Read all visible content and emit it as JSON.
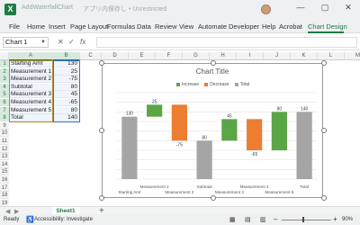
{
  "app": {
    "logo_letter": "X",
    "filename": "AddWaterfallChart",
    "save_state": "アプリ内保存し",
    "save_state_sep": "•",
    "save_state_suffix": "Unrestricted"
  },
  "window": {
    "minimize": "—",
    "restore": "▢",
    "close": "✕"
  },
  "menu": [
    "File",
    "Home",
    "Insert",
    "Page Layout",
    "Formulas",
    "Data",
    "Review",
    "View",
    "Automate",
    "Developer",
    "Help",
    "Acrobat",
    "Chart Design"
  ],
  "menu_active": "Chart Design",
  "formula": {
    "namebox": "Chart 1",
    "cancel": "✕",
    "enter": "✓",
    "fx": "fx",
    "value": ""
  },
  "columns": [
    "A",
    "B",
    "C",
    "D",
    "E",
    "F",
    "G",
    "H",
    "I",
    "J",
    "K",
    "L",
    "M"
  ],
  "rows": [
    "1",
    "2",
    "3",
    "4",
    "5",
    "6",
    "7",
    "8",
    "9",
    "10",
    "11",
    "12",
    "13",
    "14",
    "15",
    "16",
    "17",
    "18",
    "19",
    "20"
  ],
  "table": [
    {
      "label": "Starting Amt",
      "value": "130"
    },
    {
      "label": "Measurement 1",
      "value": "25"
    },
    {
      "label": "Measurement 2",
      "value": "-75"
    },
    {
      "label": "Subtotal",
      "value": "80"
    },
    {
      "label": "Measurement 3",
      "value": "45"
    },
    {
      "label": "Measurement 4",
      "value": "-65"
    },
    {
      "label": "Measurement 5",
      "value": "80"
    },
    {
      "label": "Total",
      "value": "140"
    }
  ],
  "chart_data": {
    "type": "bar",
    "title": "Chart Title",
    "categories": [
      "Starting Amt",
      "Measurement 1",
      "Measurement 2",
      "Subtotal",
      "Measurement 3",
      "Measurement 4",
      "Measurement 5",
      "Total"
    ],
    "values": [
      130,
      25,
      -75,
      80,
      45,
      -65,
      80,
      140
    ],
    "kinds": [
      "total",
      "increase",
      "decrease",
      "total",
      "increase",
      "decrease",
      "increase",
      "total"
    ],
    "legend": [
      {
        "name": "Increase",
        "color": "#5aa646"
      },
      {
        "name": "Decrease",
        "color": "#ec7d31"
      },
      {
        "name": "Total",
        "color": "#a5a5a5"
      }
    ],
    "ylim": [
      0,
      180
    ],
    "yticks": [
      0,
      20,
      40,
      60,
      80,
      100,
      120,
      140,
      160,
      180
    ],
    "grid": true,
    "legend_position": "top"
  },
  "sheet": {
    "name": "Sheet1",
    "add": "+"
  },
  "status": {
    "ready": "Ready",
    "accessibility": "Accessibility: Investigate",
    "zoom": "90%"
  }
}
